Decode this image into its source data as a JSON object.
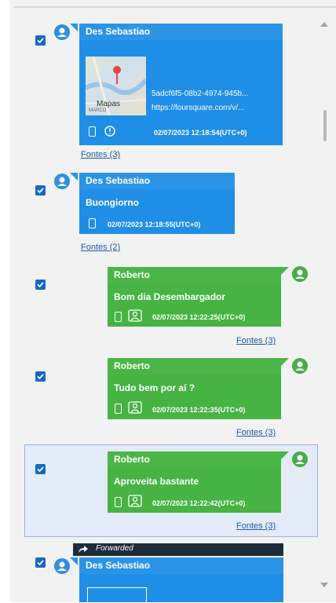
{
  "messages": [
    {
      "sender": "Des Sebastiao",
      "text": "",
      "link_id": "5adcf6f5-08b2-4974-945b...",
      "link_url": "https://foursquare.com/v/...",
      "map_label": "Mapas",
      "map_sub": "MARCO",
      "timestamp": "02/07/2023 12:18:54(UTC+0)",
      "fontes": "Fontes (3)"
    },
    {
      "sender": "Des Sebastiao",
      "text": "Buongiorno",
      "timestamp": "02/07/2023 12:18:55(UTC+0)",
      "fontes": "Fontes (2)"
    },
    {
      "sender": "Roberto",
      "text": "Bom dia Desembargador",
      "timestamp": "02/07/2023 12:22:25(UTC+0)",
      "fontes": "Fontes (3)"
    },
    {
      "sender": "Roberto",
      "text": "Tudo bem por aí ?",
      "timestamp": "02/07/2023 12:22:35(UTC+0)",
      "fontes": "Fontes (3)"
    },
    {
      "sender": "Roberto",
      "text": "Aproveita bastante",
      "timestamp": "02/07/2023 12:22:42(UTC+0)",
      "fontes": "Fontes (3)"
    },
    {
      "sender": "Des Sebastiao",
      "forwarded": "Forwarded"
    }
  ],
  "colors": {
    "incoming": "#1f8ee6",
    "outgoing": "#46b343",
    "checkbox": "#1668c6",
    "link": "#1c5da8"
  }
}
